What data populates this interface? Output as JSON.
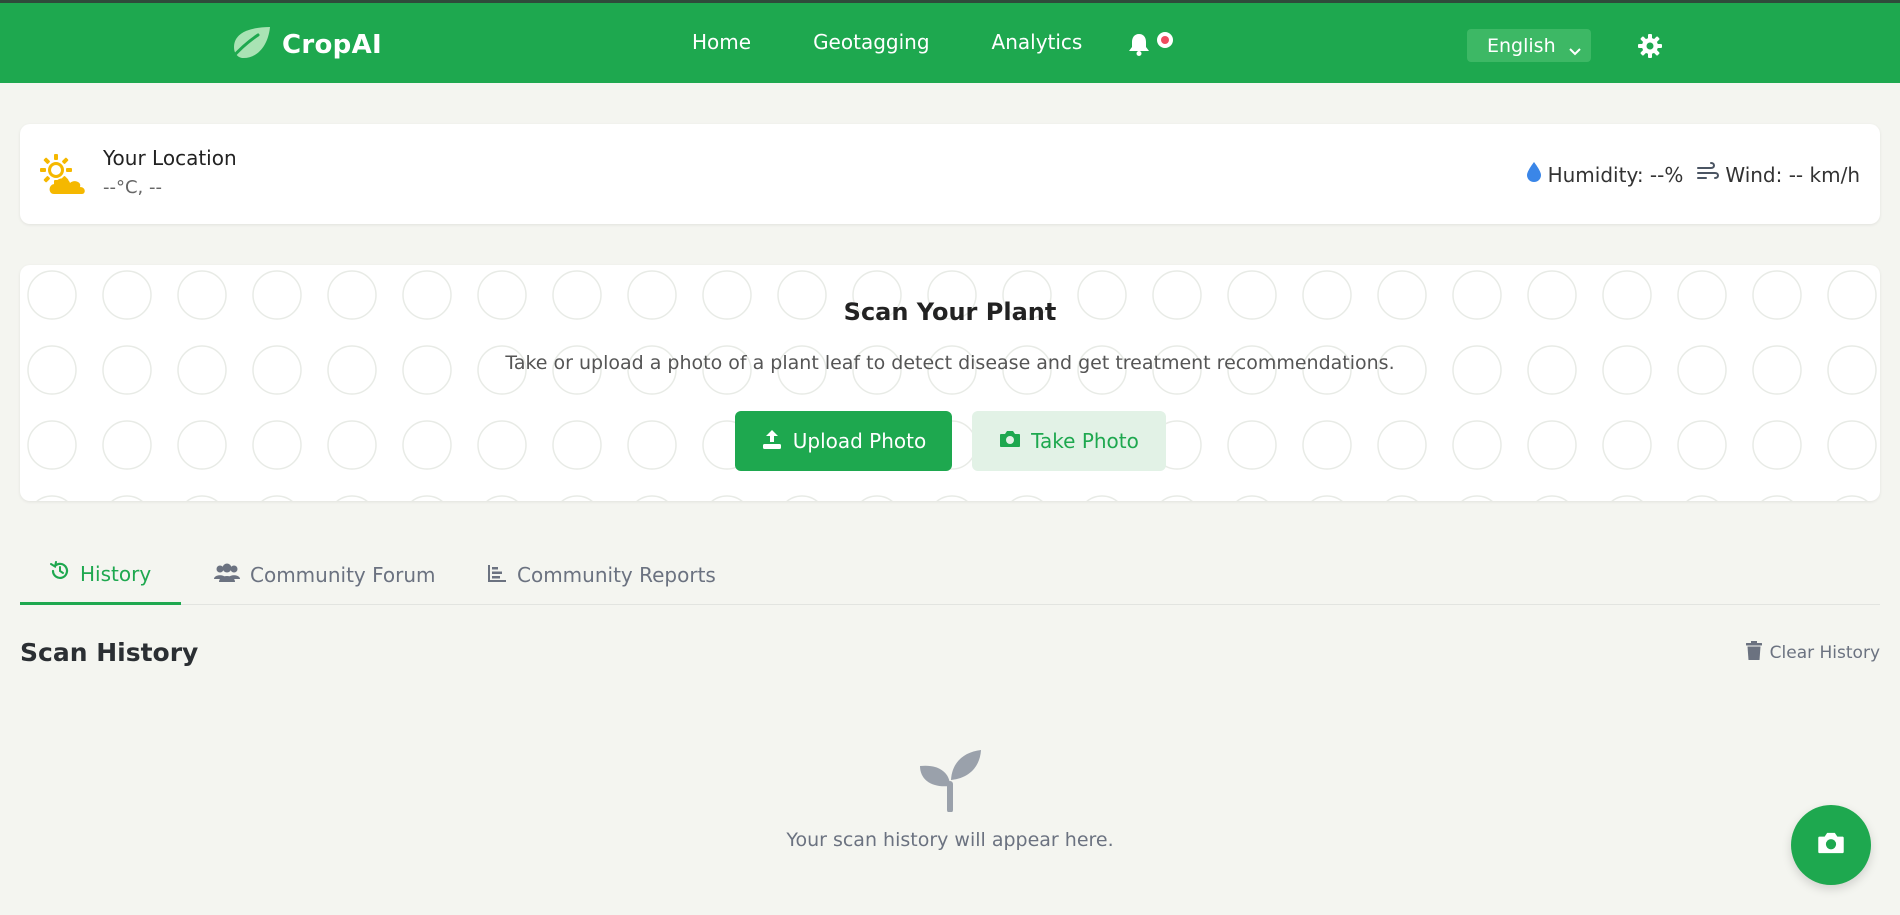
{
  "app": {
    "brand": "CropAI"
  },
  "nav": {
    "links": [
      "Home",
      "Geotagging",
      "Analytics"
    ],
    "language": "English"
  },
  "weather": {
    "location": "Your Location",
    "temp": "--°C, --",
    "humidity": "Humidity: --%",
    "wind": "Wind: -- km/h"
  },
  "scan": {
    "title": "Scan Your Plant",
    "description": "Take or upload a photo of a plant leaf to detect disease and get treatment recommendations.",
    "upload_label": "Upload Photo",
    "take_label": "Take Photo"
  },
  "tabs": [
    "History",
    "Community Forum",
    "Community Reports"
  ],
  "history": {
    "title": "Scan History",
    "clear_label": "Clear History",
    "empty_text": "Your scan history will appear here."
  },
  "colors": {
    "primary": "#1ea84f",
    "background": "#f4f5f0"
  }
}
